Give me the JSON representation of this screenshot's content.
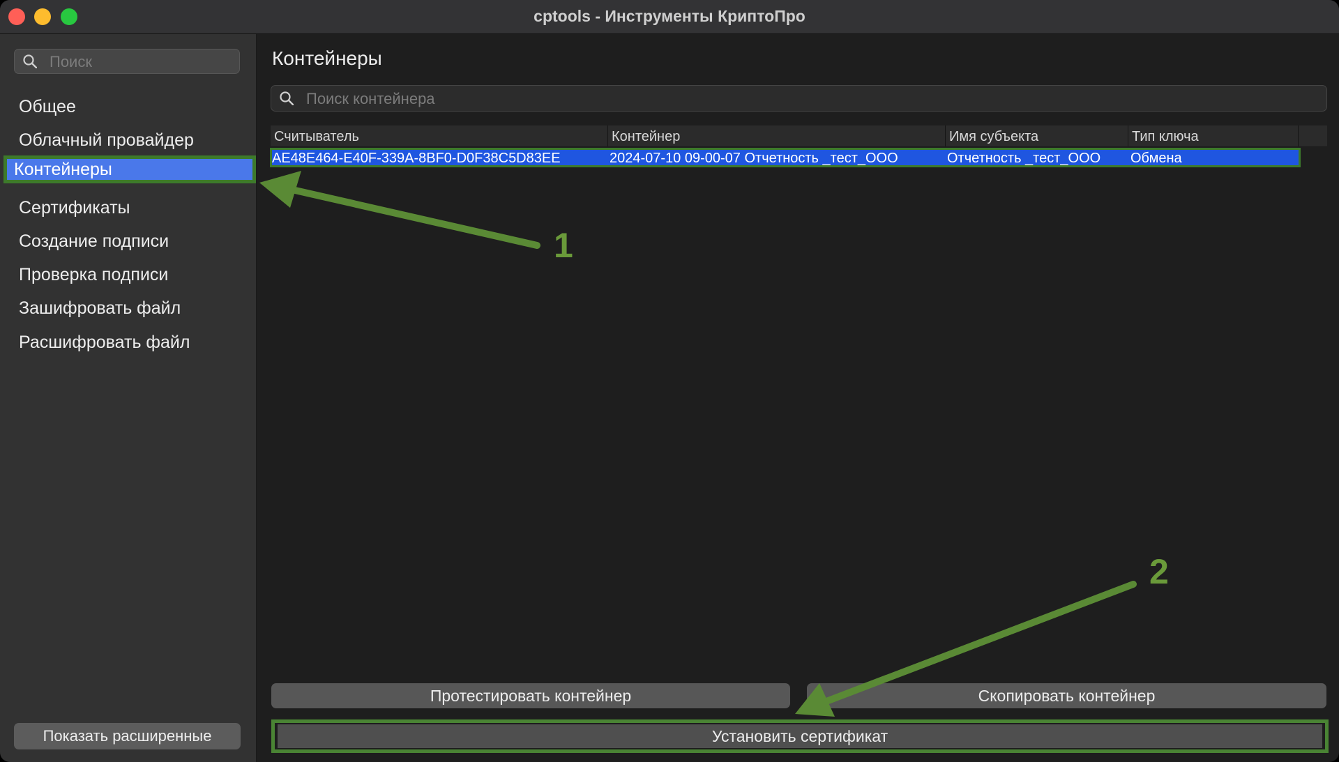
{
  "window": {
    "title": "cptools - Инструменты КриптоПро"
  },
  "sidebar": {
    "search_placeholder": "Поиск",
    "items": [
      {
        "label": "Общее"
      },
      {
        "label": "Облачный провайдер"
      },
      {
        "label": "Контейнеры",
        "selected": true
      },
      {
        "label": "Сертификаты"
      },
      {
        "label": "Создание подписи"
      },
      {
        "label": "Проверка подписи"
      },
      {
        "label": "Зашифровать файл"
      },
      {
        "label": "Расшифровать файл"
      }
    ],
    "show_advanced_label": "Показать расширенные"
  },
  "main": {
    "title": "Контейнеры",
    "search_placeholder": "Поиск контейнера",
    "table": {
      "columns": [
        "Считыватель",
        "Контейнер",
        "Имя субъекта",
        "Тип ключа"
      ],
      "rows": [
        [
          "AE48E464-E40F-339A-8BF0-D0F38C5D83EE",
          "2024-07-10 09-00-07 Отчетность _тест_ООО",
          "Отчетность _тест_ООО",
          "Обмена"
        ]
      ]
    },
    "buttons": {
      "test_container": "Протестировать контейнер",
      "copy_container": "Скопировать контейнер",
      "install_certificate": "Установить сертификат"
    }
  },
  "annotations": {
    "marker_1": "1",
    "marker_2": "2",
    "color": "#6a9a3a"
  }
}
